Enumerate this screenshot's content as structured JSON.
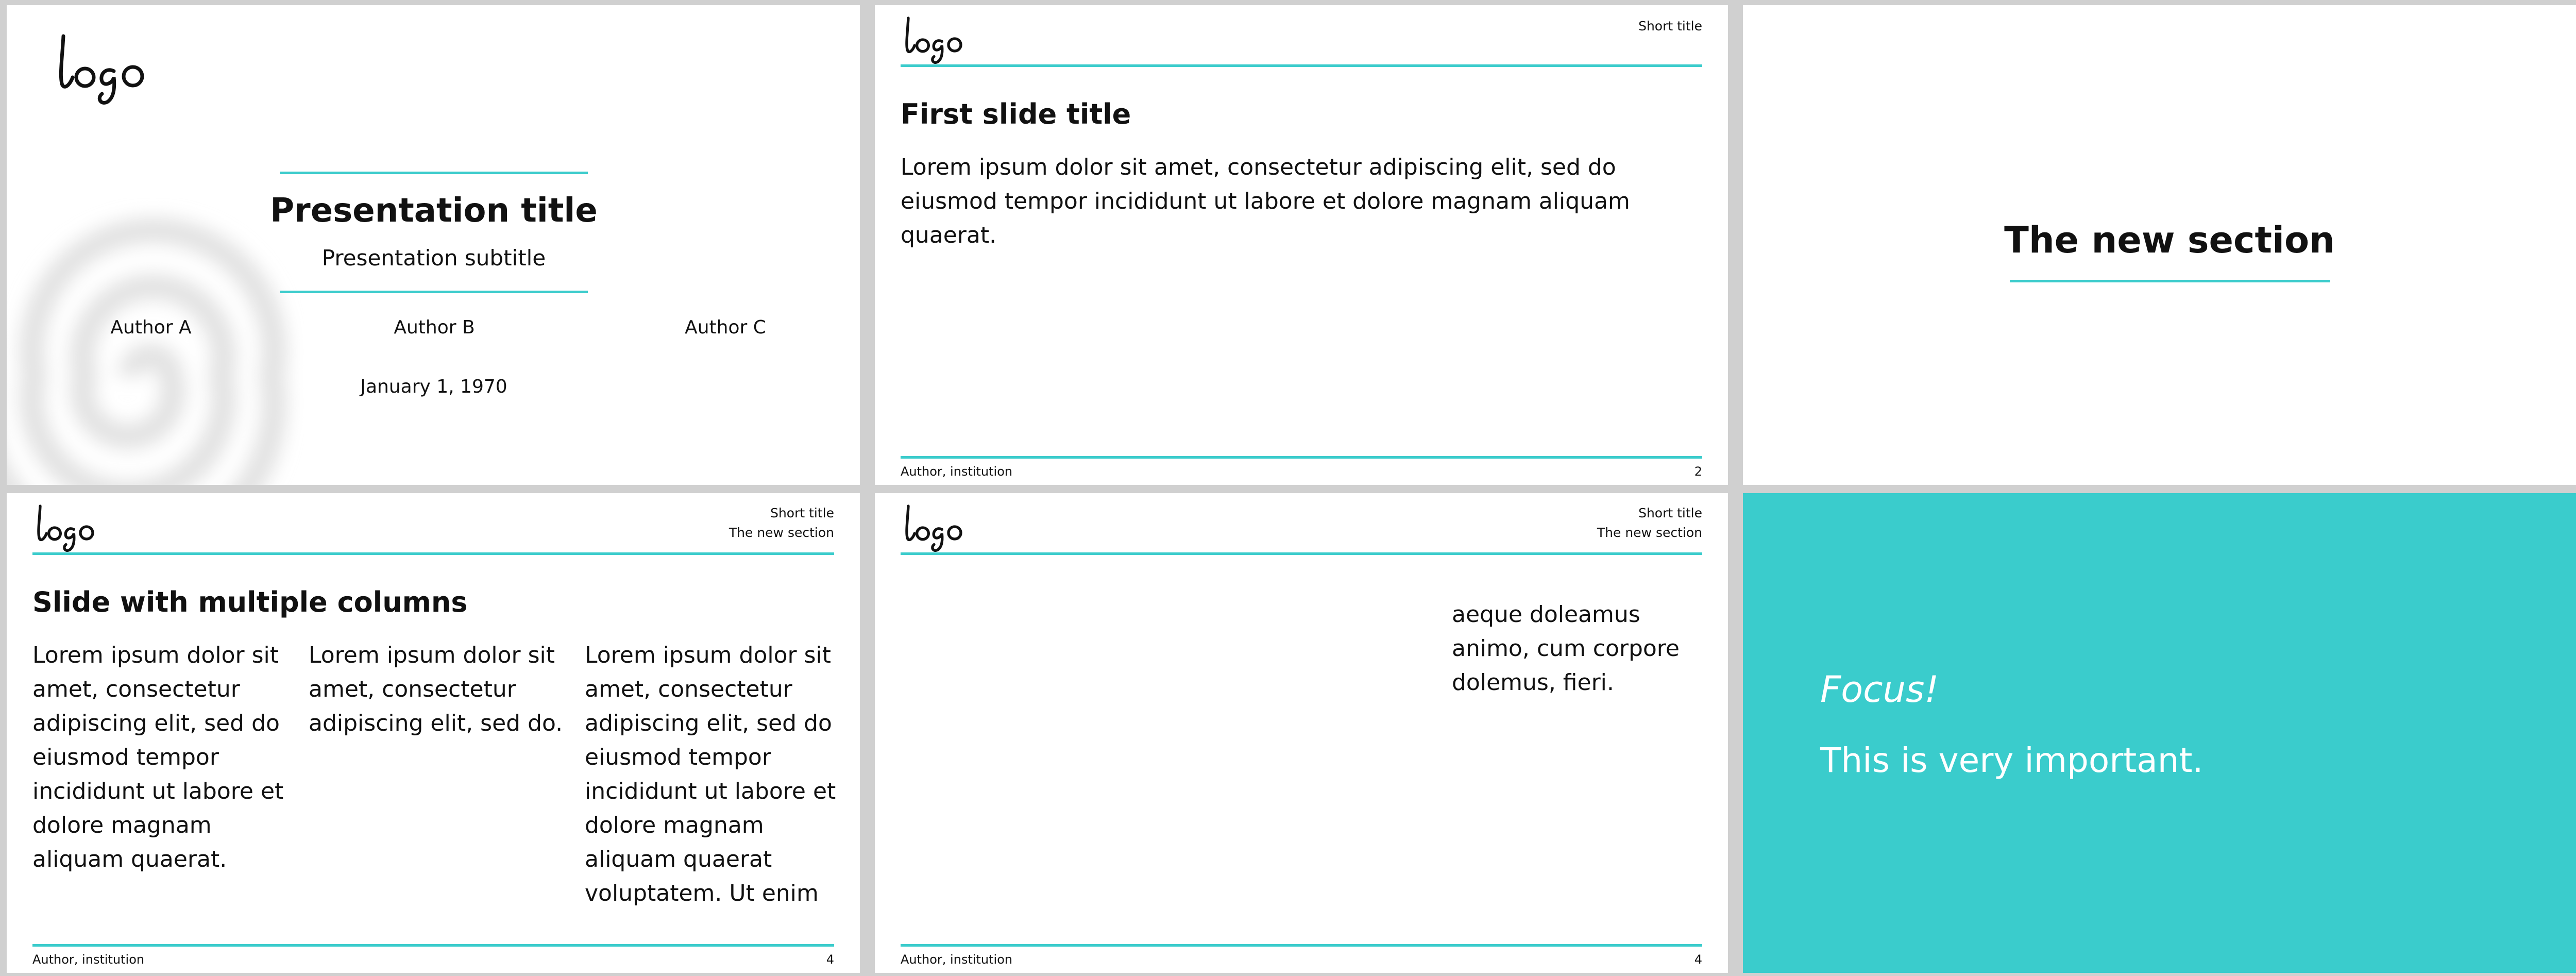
{
  "title_slide": {
    "title": "Presentation title",
    "subtitle": "Presentation subtitle",
    "authors": [
      "Author A",
      "Author B",
      "Author C"
    ],
    "date": "January 1, 1970",
    "logo_text": "logo"
  },
  "slide_2": {
    "header": "Short title",
    "title": "First slide title",
    "body": "Lorem ipsum dolor sit amet, consectetur adipiscing elit, sed do eiusmod tempor incididunt ut labore et dolore magnam aliquam quaerat.",
    "footer_left": "Author, institution",
    "page": "2"
  },
  "slide_3": {
    "section_title": "The new section"
  },
  "slide_4": {
    "header_line1": "Short title",
    "header_line2": "The new section",
    "title": "Slide with multiple columns",
    "col1": "Lorem ipsum dolor sit amet, consectetur adipiscing elit, sed do eiusmod tempor incididunt ut labore et dolore magnam aliquam quaerat.",
    "col2": "Lorem ipsum dolor sit amet, consectetur adipiscing elit, sed do.",
    "col3": "Lorem ipsum dolor sit amet, consectetur adipiscing elit, sed do eiusmod tempor incididunt ut labore et dolore magnam aliquam quaerat voluptatem. Ut enim",
    "footer_left": "Author, institution",
    "page": "4"
  },
  "slide_5": {
    "header_line1": "Short title",
    "header_line2": "The new section",
    "body": "aeque doleamus animo, cum corpore dolemus, fieri.",
    "footer_left": "Author, institution",
    "page": "4"
  },
  "slide_6": {
    "focus_title": "Focus!",
    "focus_text": "This is very important."
  },
  "colors": {
    "accent": "#3ccccc",
    "background": "#d0d0d0",
    "slide": "#ffffff"
  }
}
